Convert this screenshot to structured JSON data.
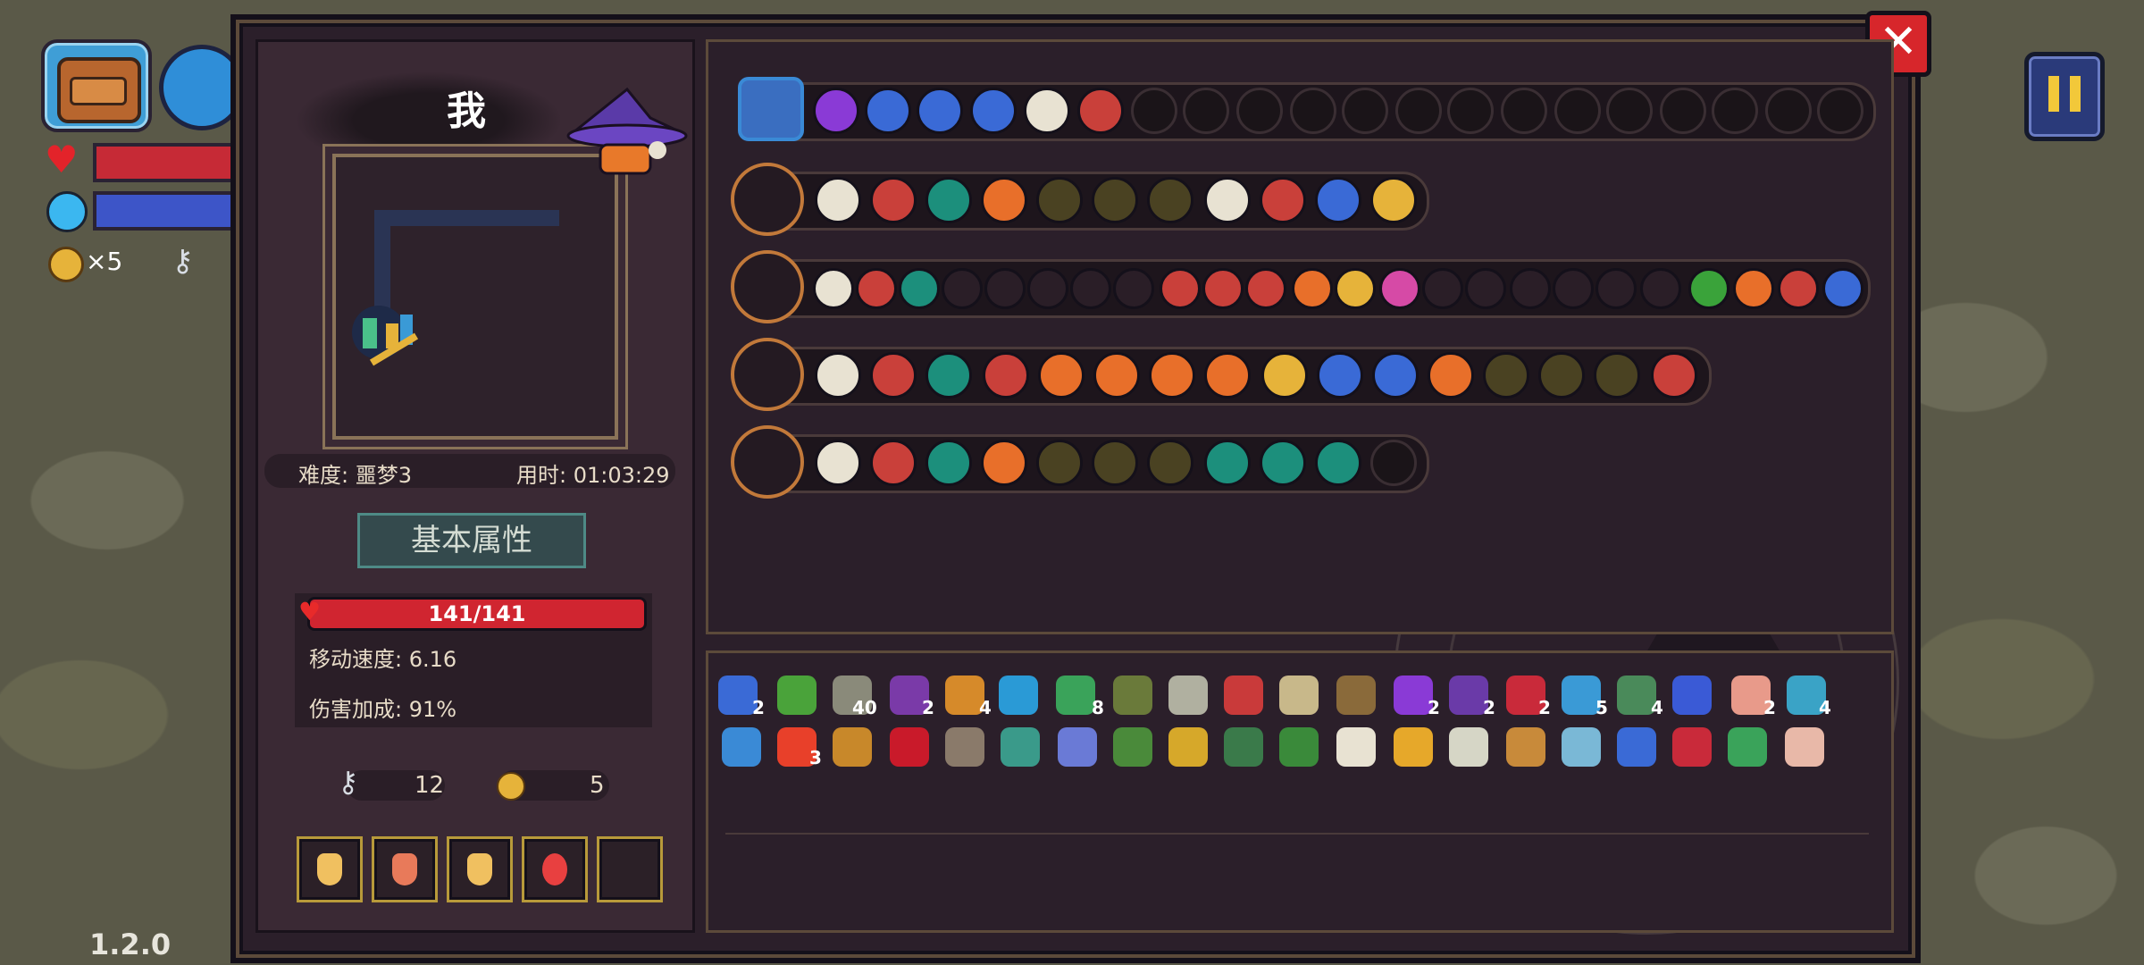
{
  "hud": {
    "coin_count": "×5",
    "version": "1.2.0",
    "icons": [
      "bag-icon",
      "broom-icon",
      "heart-icon",
      "mana-icon",
      "coin-icon",
      "key-icon",
      "pause-icon"
    ]
  },
  "character": {
    "name": "我",
    "difficulty": "难度: 噩梦3",
    "time": "用时: 01:03:29",
    "attributes_button": "基本属性",
    "hp": "141/141",
    "move_speed": "移动速度: 6.16",
    "damage_bonus": "伤害加成: 91%",
    "keys": "12",
    "coins": "5"
  },
  "close_label": "✕",
  "item_counts": [
    "2",
    "40",
    "2",
    "4",
    "8",
    "2",
    "2",
    "2",
    "5",
    "4",
    "2",
    "4",
    "3"
  ],
  "colors": {
    "accent": "#c2793a",
    "panel": "#2b1f2a",
    "hp": "#d02530"
  }
}
